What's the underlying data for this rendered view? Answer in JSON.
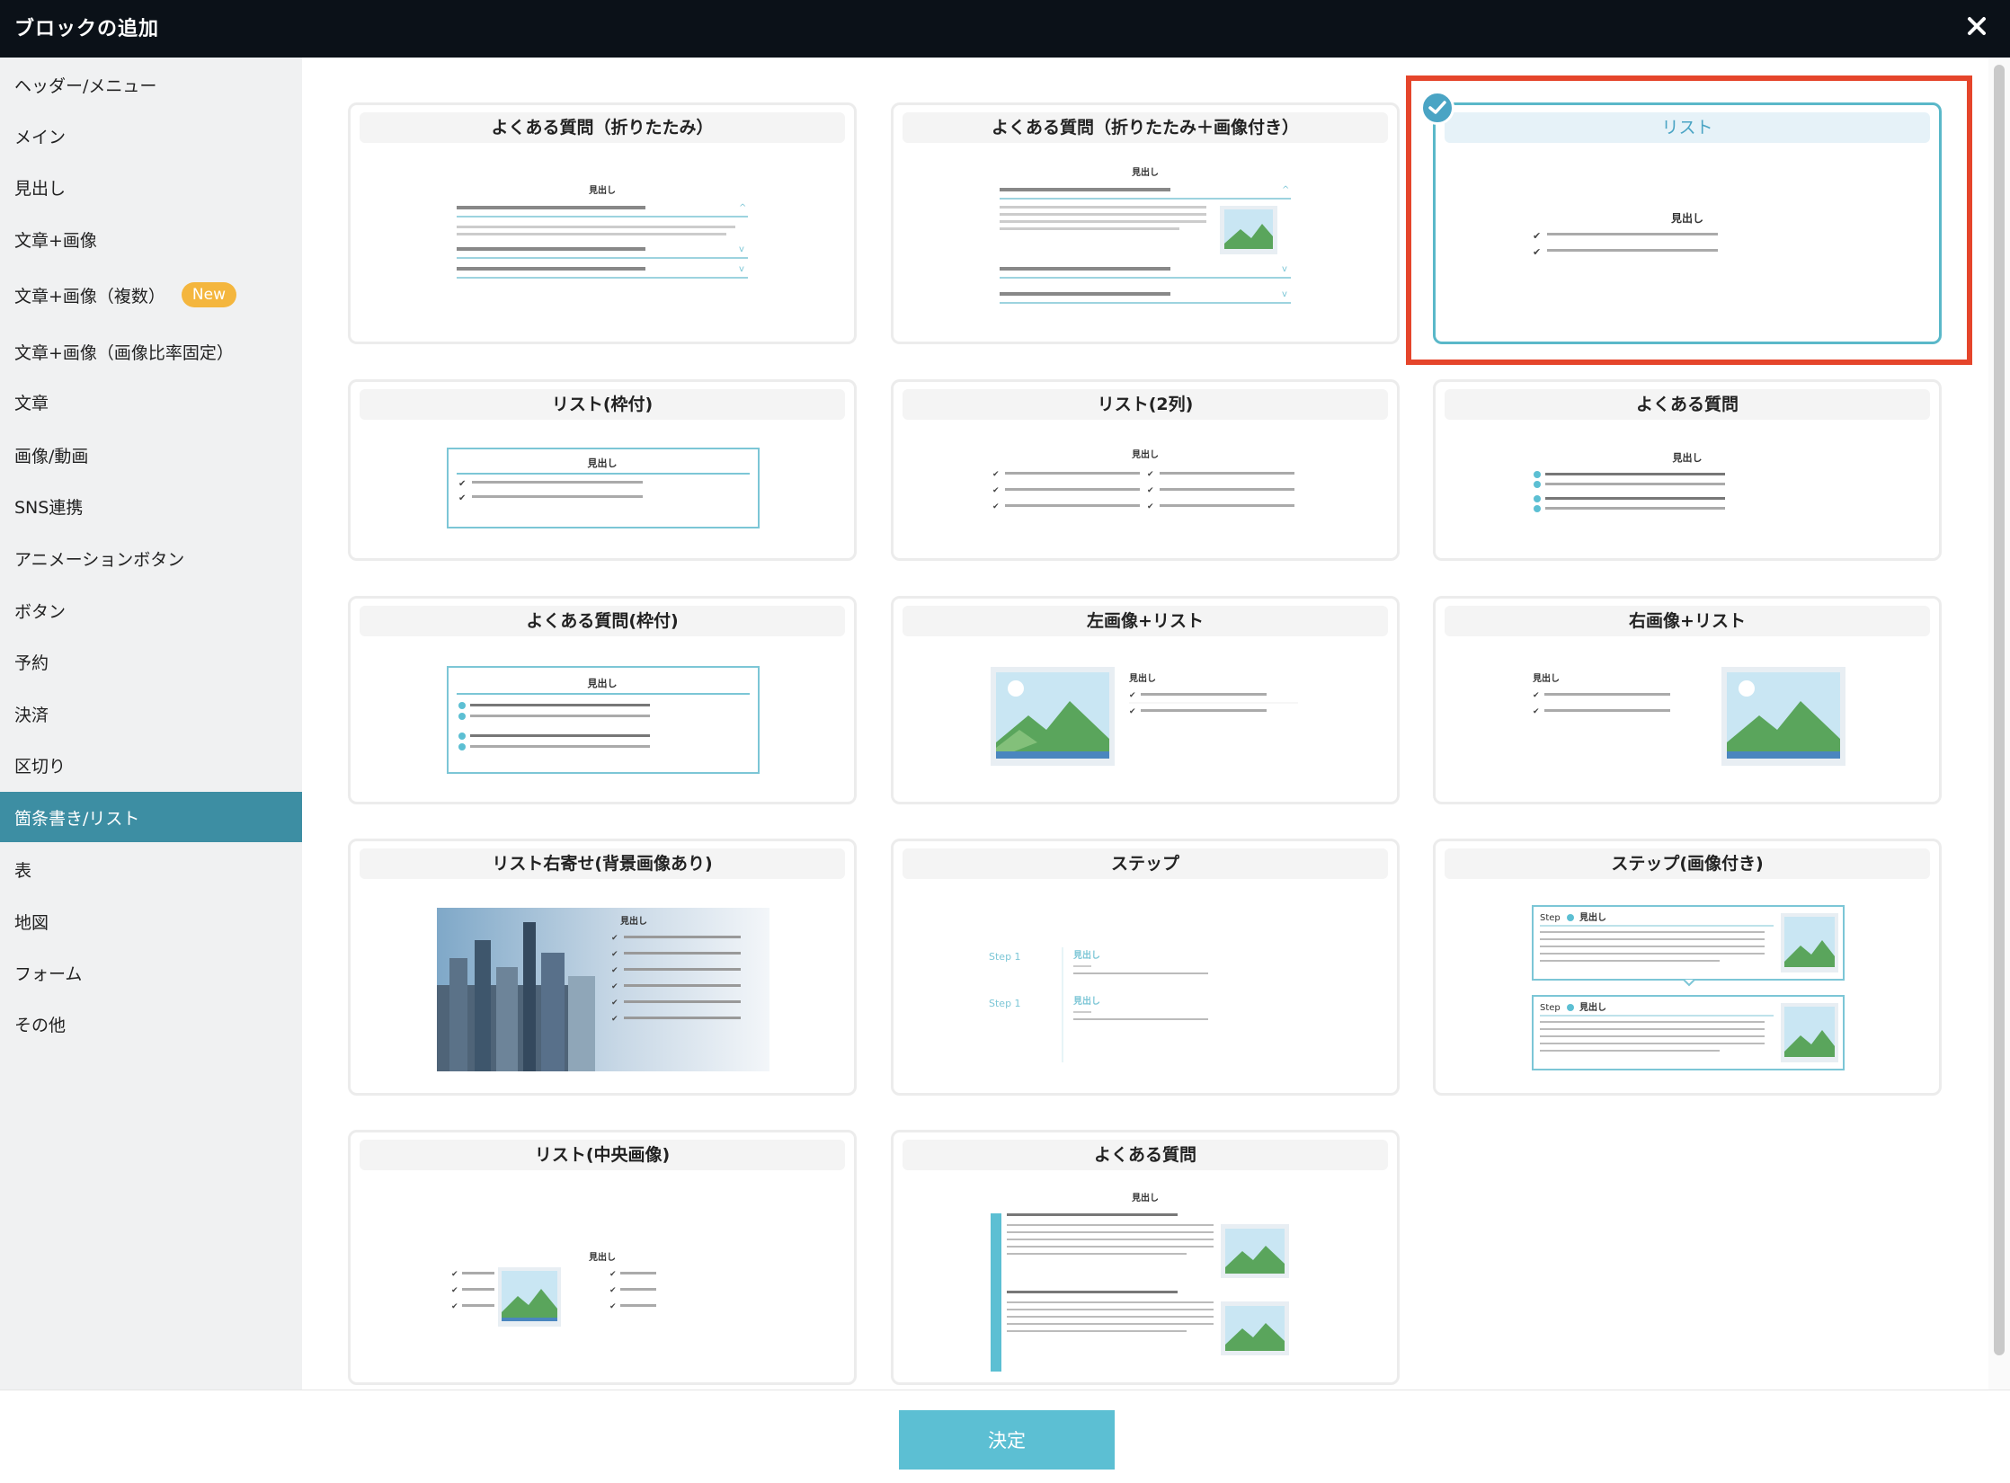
{
  "dialog": {
    "title": "ブロックの追加",
    "close_label": "×"
  },
  "sidebar": {
    "items": [
      {
        "label": "ヘッダー/メニュー"
      },
      {
        "label": "メイン"
      },
      {
        "label": "見出し"
      },
      {
        "label": "文章+画像"
      },
      {
        "label": "文章+画像（複数）",
        "badge": "New"
      },
      {
        "label": "文章+画像（画像比率固定）"
      },
      {
        "label": "文章"
      },
      {
        "label": "画像/動画"
      },
      {
        "label": "SNS連携"
      },
      {
        "label": "アニメーションボタン"
      },
      {
        "label": "ボタン"
      },
      {
        "label": "予約"
      },
      {
        "label": "決済"
      },
      {
        "label": "区切り"
      },
      {
        "label": "箇条書き/リスト",
        "active": true
      },
      {
        "label": "表"
      },
      {
        "label": "地図"
      },
      {
        "label": "フォーム"
      },
      {
        "label": "その他"
      }
    ]
  },
  "cards": [
    {
      "title": "よくある質問（折りたたみ）"
    },
    {
      "title": "よくある質問（折りたたみ＋画像付き）"
    },
    {
      "title": "リスト",
      "selected": true
    },
    {
      "title": "リスト(枠付)"
    },
    {
      "title": "リスト(2列)"
    },
    {
      "title": "よくある質問"
    },
    {
      "title": "よくある質問(枠付)"
    },
    {
      "title": "左画像+リスト"
    },
    {
      "title": "右画像+リスト"
    },
    {
      "title": "リスト右寄せ(背景画像あり)"
    },
    {
      "title": "ステップ"
    },
    {
      "title": "ステップ(画像付き)"
    },
    {
      "title": "リスト(中央画像)"
    },
    {
      "title": "よくある質問"
    }
  ],
  "preview_text": {
    "heading": "見出し",
    "step_label": "Step 1",
    "step_short": "Step"
  },
  "footer": {
    "confirm_label": "決定"
  },
  "colors": {
    "accent": "#5cbfd3",
    "selected_border": "#5ab8c9",
    "highlight": "#e5452b",
    "active_sidebar": "#3d8ea3",
    "badge": "#f4b63e"
  }
}
